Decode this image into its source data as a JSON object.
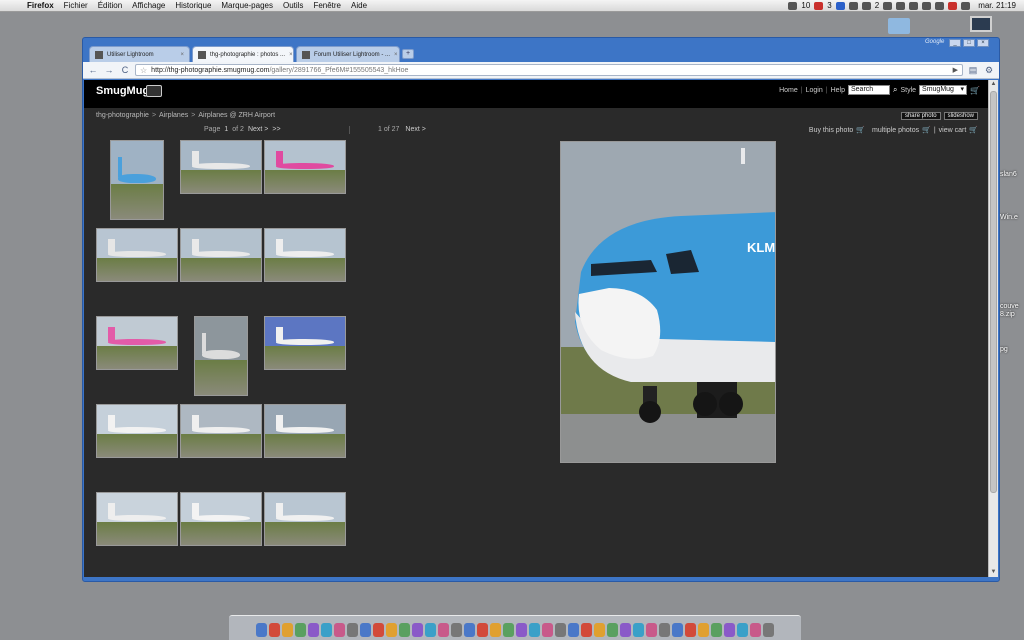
{
  "menubar": {
    "app": "Firefox",
    "menus": [
      "Fichier",
      "Édition",
      "Affichage",
      "Historique",
      "Marque-pages",
      "Outils",
      "Fenêtre",
      "Aide"
    ],
    "status_counts": [
      "10",
      "3",
      "2"
    ],
    "clock": "mar. 21:19"
  },
  "desktop": {
    "labels": [
      "slan6",
      "Win.e",
      "couve",
      "8.zip",
      "pg"
    ]
  },
  "browser": {
    "tabs": [
      {
        "title": "Utiliser Lightroom",
        "close": "×"
      },
      {
        "title": "thg-photographie : photos ...",
        "close": "×"
      },
      {
        "title": "Forum Utiliser Lightroom - ...",
        "close": "×"
      }
    ],
    "new_tab": "+",
    "brand": "Google",
    "url_host": "http://thg-photographie.smugmug.com",
    "url_path": "/gallery/2891766_Pfe6M#155505543_hkHoe",
    "nav": {
      "back": "←",
      "forward": "→",
      "reload": "C",
      "go": "▶",
      "page": "▤",
      "tools": "⚙"
    }
  },
  "site": {
    "logo": "SmugMug",
    "nav": [
      "Home",
      "Login",
      "Help"
    ],
    "search_placeholder": "Search",
    "style_label": "Style",
    "style_value": "SmugMug",
    "breadcrumb": [
      "thg-photographie",
      ">",
      "Airplanes",
      ">",
      "Airplanes @ ZRH Airport"
    ],
    "share_button": "share photo",
    "slideshow_button": "slideshow",
    "pager": {
      "page": "Page",
      "current": "1",
      "of": "of 2",
      "next": "Next >",
      "last": ">>"
    },
    "photo_pager": {
      "count": "1 of 27",
      "next": "Next >"
    },
    "cart": {
      "buy": "Buy this photo",
      "multiple": "multiple photos",
      "view": "view cart"
    }
  },
  "thumbnails": [
    {
      "row": 0,
      "col": 0,
      "portrait": true,
      "sky": "#9fb2c4",
      "body": "#4aa0dc"
    },
    {
      "row": 0,
      "col": 1,
      "portrait": false,
      "sky": "#a7b7c6",
      "body": "#e8e8e8"
    },
    {
      "row": 0,
      "col": 2,
      "portrait": false,
      "sky": "#b4c2cf",
      "body": "#e04aa0"
    },
    {
      "row": 1,
      "col": 0,
      "portrait": false,
      "sky": "#b8c5d2",
      "body": "#e6e6e6"
    },
    {
      "row": 1,
      "col": 1,
      "portrait": false,
      "sky": "#b3c1cd",
      "body": "#e9e9e9"
    },
    {
      "row": 1,
      "col": 2,
      "portrait": false,
      "sky": "#b6c4d0",
      "body": "#eeeeee"
    },
    {
      "row": 2,
      "col": 0,
      "portrait": false,
      "sky": "#c0cad3",
      "body": "#e35ba8"
    },
    {
      "row": 2,
      "col": 1,
      "portrait": true,
      "sky": "#8d969c",
      "body": "#dcdcdc"
    },
    {
      "row": 2,
      "col": 2,
      "portrait": false,
      "sky": "#5c76c2",
      "body": "#f0f0f0"
    },
    {
      "row": 3,
      "col": 0,
      "portrait": false,
      "sky": "#c5d0da",
      "body": "#f2f2f2"
    },
    {
      "row": 3,
      "col": 1,
      "portrait": false,
      "sky": "#aeb8c2",
      "body": "#efefef"
    },
    {
      "row": 3,
      "col": 2,
      "portrait": false,
      "sky": "#98a6b3",
      "body": "#f1f1f1"
    },
    {
      "row": 4,
      "col": 0,
      "portrait": false,
      "sky": "#c9d3dc",
      "body": "#eeeeee"
    },
    {
      "row": 4,
      "col": 1,
      "portrait": false,
      "sky": "#c4cfd9",
      "body": "#f3f3f3"
    },
    {
      "row": 4,
      "col": 2,
      "portrait": false,
      "sky": "#b9c6d2",
      "body": "#f0f0f0"
    }
  ],
  "main_photo": {
    "livery_text": "KLM",
    "colors": {
      "sky": "#9ea8b1",
      "upper": "#3c9ad8",
      "nose": "#f4f4f4",
      "ground": "#6f7a4a"
    }
  },
  "dock": {
    "icon_count": 40
  }
}
